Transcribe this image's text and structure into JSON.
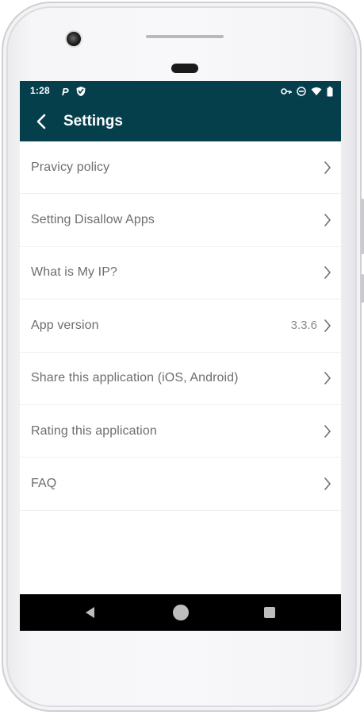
{
  "status": {
    "time": "1:28",
    "left_icons": [
      "parking-icon",
      "shield-notification-icon"
    ],
    "right_icons": [
      "vpn-key-icon",
      "do-not-disturb-icon",
      "wifi-icon",
      "battery-icon"
    ]
  },
  "appbar": {
    "title": "Settings",
    "back_icon": "chevron-left-icon"
  },
  "settings": [
    {
      "label": "Pravicy policy",
      "value": ""
    },
    {
      "label": "Setting Disallow Apps",
      "value": ""
    },
    {
      "label": "What is My IP?",
      "value": ""
    },
    {
      "label": "App version",
      "value": "3.3.6"
    },
    {
      "label": "Share this application (iOS, Android)",
      "value": ""
    },
    {
      "label": "Rating this application",
      "value": ""
    },
    {
      "label": "FAQ",
      "value": ""
    }
  ],
  "navbar": {
    "icons": [
      "nav-back-icon",
      "nav-home-icon",
      "nav-recents-icon"
    ]
  },
  "colors": {
    "header": "#063f4c",
    "text": "#6e6e6e",
    "navbar": "#000000"
  }
}
